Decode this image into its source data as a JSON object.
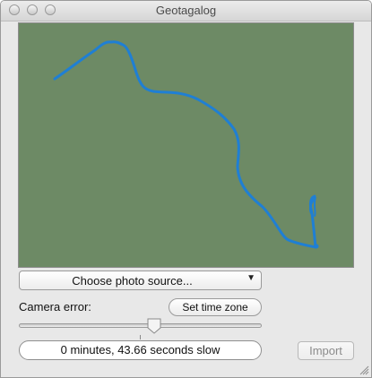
{
  "window": {
    "title": "Geotagalog"
  },
  "map": {
    "background_color": "#6d8a65",
    "track_color": "#1f7fd4"
  },
  "controls": {
    "photo_source_label": "Choose photo source...",
    "camera_error_label": "Camera error:",
    "set_time_zone_label": "Set time zone",
    "offset_text": "0 minutes, 43.66 seconds slow",
    "import_label": "Import",
    "slider_fraction": 0.56
  },
  "icons": {
    "close": "close-icon",
    "minimize": "minimize-icon",
    "zoom": "zoom-icon",
    "popup_arrow": "chevron-updown-icon",
    "resize": "resize-grip-icon"
  }
}
